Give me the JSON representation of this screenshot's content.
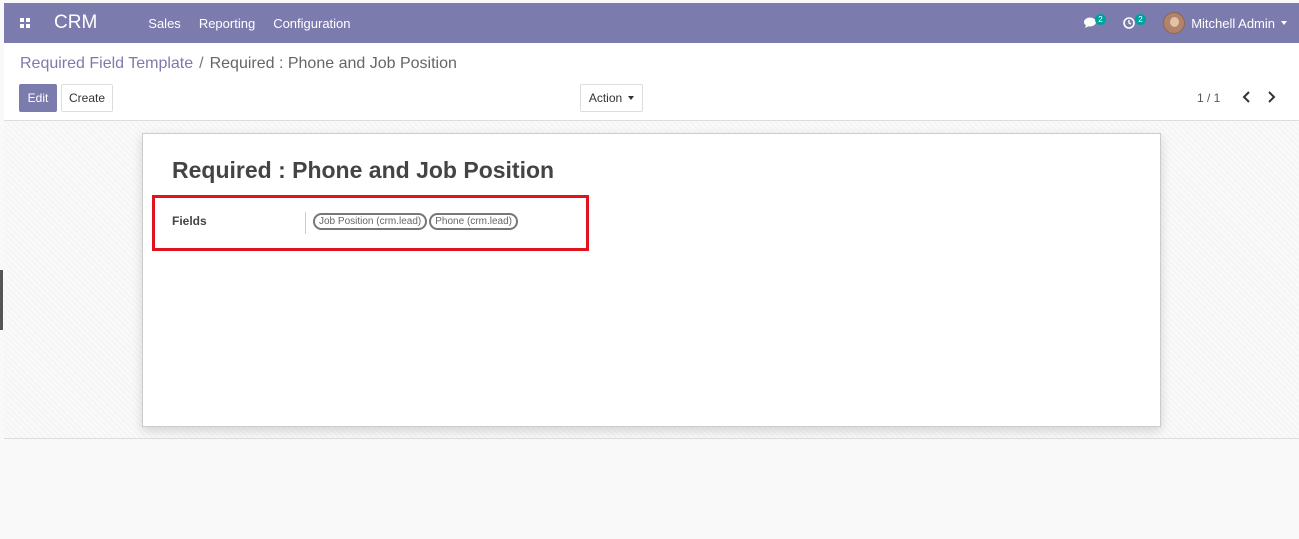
{
  "navbar": {
    "brand": "CRM",
    "menu": [
      "Sales",
      "Reporting",
      "Configuration"
    ],
    "messages_count": "2",
    "activities_count": "2",
    "user_name": "Mitchell Admin",
    "color": "#7c7bad"
  },
  "breadcrumb": {
    "parent": "Required Field Template",
    "separator": "/",
    "current": "Required : Phone and Job Position"
  },
  "buttons": {
    "edit": "Edit",
    "create": "Create",
    "action": "Action"
  },
  "pager": {
    "value": "1 / 1"
  },
  "record": {
    "title": "Required : Phone and Job Position",
    "field_label": "Fields",
    "tags": [
      "Job Position (crm.lead)",
      "Phone (crm.lead)"
    ]
  },
  "icons": {
    "apps": "apps-grid-icon",
    "messages": "chat-bubble-icon",
    "activities": "clock-icon",
    "prev": "chevron-left-icon",
    "next": "chevron-right-icon"
  },
  "highlight_color": "#e0141e"
}
